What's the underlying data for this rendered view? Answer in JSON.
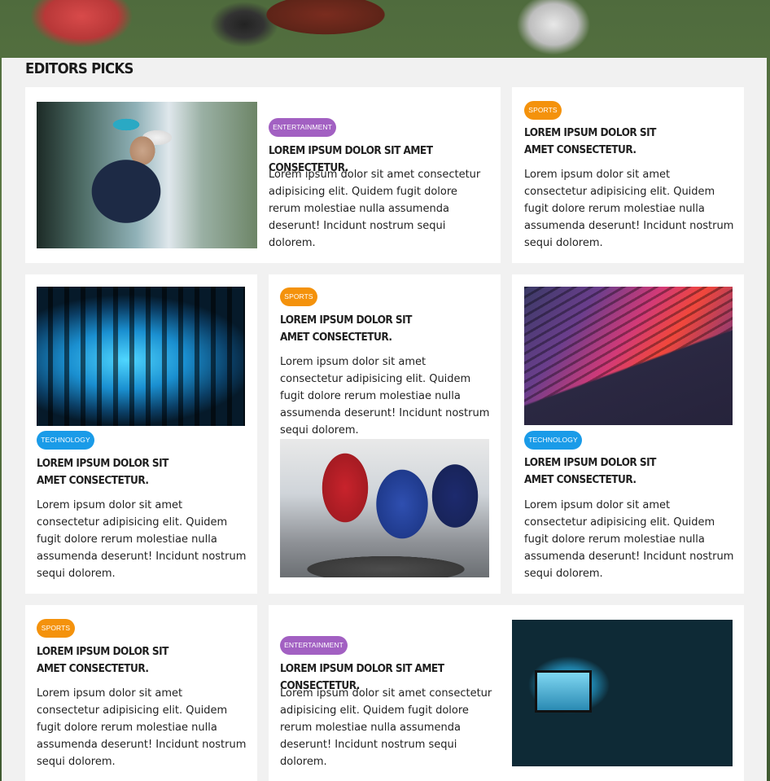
{
  "section_title": "EDITORS PICKS",
  "categories": {
    "entertainment": "ENTERTAINMENT",
    "sports": "SPORTS",
    "technology": "TECHNOLOGY"
  },
  "colors": {
    "entertainment": "#a260c2",
    "sports": "#f4920c",
    "technology": "#1a9be8",
    "background": "#f1f1f1",
    "card": "#ffffff"
  },
  "articles": [
    {
      "category": "ENTERTAINMENT",
      "title": "LOREM IPSUM DOLOR SIT AMET CONSECTETUR.",
      "excerpt": "Lorem ipsum dolor sit amet consectetur adipisicing elit. Quidem fugit dolore rerum molestiae nulla assumenda deserunt! Incidunt nostrum sequi dolorem."
    },
    {
      "category": "SPORTS",
      "title": "LOREM IPSUM DOLOR SIT AMET CONSECTETUR.",
      "excerpt": "Lorem ipsum dolor sit amet consectetur adipisicing elit. Quidem fugit dolore rerum molestiae nulla assumenda deserunt! Incidunt nostrum sequi dolorem."
    },
    {
      "category": "TECHNOLOGY",
      "title": "LOREM IPSUM DOLOR SIT AMET CONSECTETUR.",
      "excerpt": "Lorem ipsum dolor sit amet consectetur adipisicing elit. Quidem fugit dolore rerum molestiae nulla assumenda deserunt! Incidunt nostrum sequi dolorem."
    },
    {
      "category": "SPORTS",
      "title": "LOREM IPSUM DOLOR SIT AMET CONSECTETUR.",
      "excerpt": "Lorem ipsum dolor sit amet consectetur adipisicing elit. Quidem fugit dolore rerum molestiae nulla assumenda deserunt! Incidunt nostrum sequi dolorem."
    },
    {
      "category": "TECHNOLOGY",
      "title": "LOREM IPSUM DOLOR SIT AMET CONSECTETUR.",
      "excerpt": "Lorem ipsum dolor sit amet consectetur adipisicing elit. Quidem fugit dolore rerum molestiae nulla assumenda deserunt! Incidunt nostrum sequi dolorem."
    },
    {
      "category": "SPORTS",
      "title": "LOREM IPSUM DOLOR SIT AMET CONSECTETUR.",
      "excerpt": "Lorem ipsum dolor sit amet consectetur adipisicing elit. Quidem fugit dolore rerum molestiae nulla assumenda deserunt! Incidunt nostrum sequi dolorem."
    },
    {
      "category": "ENTERTAINMENT",
      "title": "LOREM IPSUM DOLOR SIT AMET CONSECTETUR.",
      "excerpt": "Lorem ipsum dolor sit amet consectetur adipisicing elit. Quidem fugit dolore rerum molestiae nulla assumenda deserunt! Incidunt nostrum sequi dolorem."
    }
  ]
}
